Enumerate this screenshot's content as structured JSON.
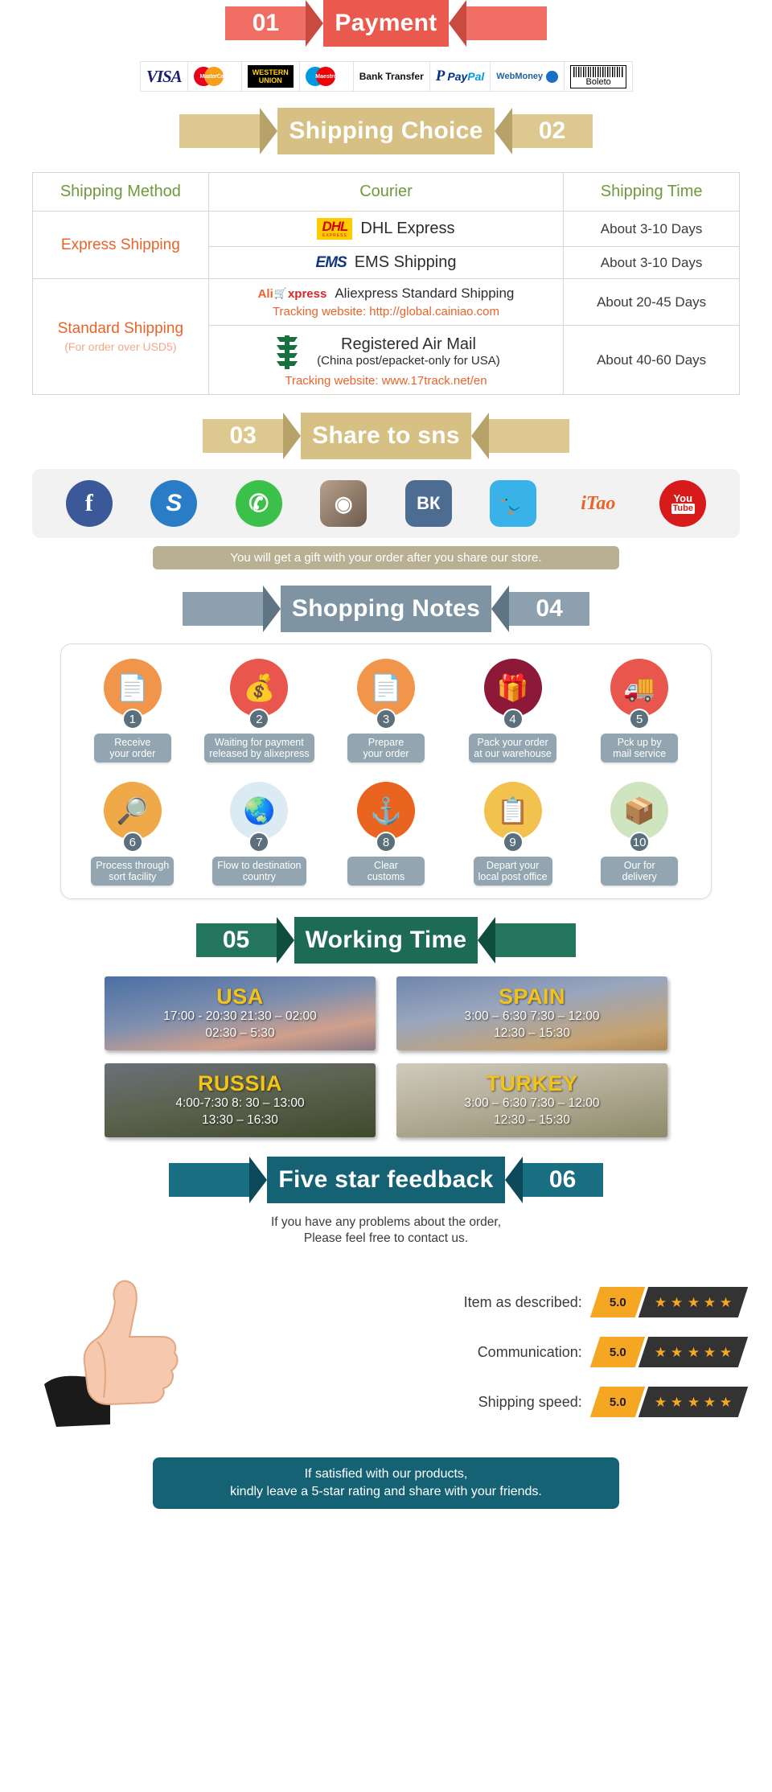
{
  "sections": {
    "payment": {
      "number": "01",
      "title": "Payment"
    },
    "shipping": {
      "number": "02",
      "title": "Shipping Choice"
    },
    "share": {
      "number": "03",
      "title": "Share to sns"
    },
    "notes": {
      "number": "04",
      "title": "Shopping Notes"
    },
    "working": {
      "number": "05",
      "title": "Working Time"
    },
    "feedback": {
      "number": "06",
      "title": "Five star feedback"
    }
  },
  "payment_methods": [
    {
      "name": "VISA",
      "icon": "visa-logo"
    },
    {
      "name": "MasterCard",
      "icon": "mastercard-logo"
    },
    {
      "name": "WESTERN UNION",
      "icon": "western-union-logo"
    },
    {
      "name": "Maestro",
      "icon": "maestro-logo"
    },
    {
      "name": "Bank Transfer",
      "icon": "bank-transfer-logo"
    },
    {
      "name": "PayPal",
      "icon": "paypal-logo"
    },
    {
      "name": "WebMoney",
      "icon": "webmoney-logo"
    },
    {
      "name": "Boleto",
      "icon": "boleto-logo"
    }
  ],
  "shipping_table": {
    "headers": {
      "method": "Shipping Method",
      "courier": "Courier",
      "time": "Shipping Time"
    },
    "groups": [
      {
        "method": "Express Shipping",
        "method_sub": "",
        "rows": [
          {
            "logo": "dhl-logo",
            "courier": "DHL Express",
            "courier_sub": "",
            "track": "",
            "time": "About 3-10 Days"
          },
          {
            "logo": "ems-logo",
            "courier": "EMS Shipping",
            "courier_sub": "",
            "track": "",
            "time": "About 3-10 Days"
          }
        ]
      },
      {
        "method": "Standard Shipping",
        "method_sub": "(For order over USD5)",
        "rows": [
          {
            "logo": "aliexpress-logo",
            "courier": "Aliexpress Standard Shipping",
            "courier_sub": "",
            "track": "Tracking website: http://global.cainiao.com",
            "time": "About 20-45 Days"
          },
          {
            "logo": "china-post-logo",
            "courier": "Registered Air Mail",
            "courier_sub": "(China post/epacket-only for USA)",
            "track": "Tracking website: www.17track.net/en",
            "time": "About 40-60 Days"
          }
        ]
      }
    ]
  },
  "social": {
    "items": [
      {
        "name": "facebook-icon",
        "label": "f",
        "color": "#3b5998",
        "shape": "circle"
      },
      {
        "name": "skype-icon",
        "label": "S",
        "color": "#2a7cc7",
        "shape": "circle"
      },
      {
        "name": "whatsapp-icon",
        "label": "✆",
        "color": "#3bc14a",
        "shape": "circle"
      },
      {
        "name": "instagram-icon",
        "label": "◉",
        "color": "#8a6a52",
        "shape": "square"
      },
      {
        "name": "vk-icon",
        "label": "ВК",
        "color": "#4c6c91",
        "shape": "square"
      },
      {
        "name": "twitter-icon",
        "label": "🐦",
        "color": "#38b2e8",
        "shape": "square"
      },
      {
        "name": "itao-icon",
        "label": "iTao",
        "color": "#ffffff",
        "shape": "plain"
      },
      {
        "name": "youtube-icon",
        "label": "You\nTube",
        "color": "#d71a1a",
        "shape": "circle"
      }
    ],
    "note": "You will get a gift with your order after you share our store."
  },
  "shopping_notes": {
    "steps": [
      {
        "num": "1",
        "label": "Receive\nyour order",
        "icon": "document-icon",
        "color": "#f0954a"
      },
      {
        "num": "2",
        "label": "Waiting for payment\nreleased by alixepress",
        "icon": "money-bag-icon",
        "color": "#e8564d"
      },
      {
        "num": "3",
        "label": "Prepare\nyour order",
        "icon": "document-icon",
        "color": "#f0954a"
      },
      {
        "num": "4",
        "label": "Pack your order\nat our warehouse",
        "icon": "gift-icon",
        "color": "#8d1838"
      },
      {
        "num": "5",
        "label": "Pck up by\nmail service",
        "icon": "mail-truck-icon",
        "color": "#e8564d"
      },
      {
        "num": "6",
        "label": "Process through\nsort facility",
        "icon": "scanner-icon",
        "color": "#f0a948"
      },
      {
        "num": "7",
        "label": "Flow to destination\ncountry",
        "icon": "globe-icon",
        "color": "#dceaf4"
      },
      {
        "num": "8",
        "label": "Clear\ncustoms",
        "icon": "anchor-icon",
        "color": "#e8641f"
      },
      {
        "num": "9",
        "label": "Depart your\nlocal post office",
        "icon": "clipboard-icon",
        "color": "#f2c14e"
      },
      {
        "num": "10",
        "label": "Our for\ndelivery",
        "icon": "package-icon",
        "color": "#cfe5c0"
      }
    ]
  },
  "working_time": {
    "cards": [
      {
        "country": "USA",
        "lines": [
          "17:00 - 20:30  21:30 – 02:00",
          "02:30 – 5:30"
        ],
        "theme": "usa"
      },
      {
        "country": "SPAIN",
        "lines": [
          "3:00 – 6:30   7:30 – 12:00",
          "12:30 – 15:30"
        ],
        "theme": "spain"
      },
      {
        "country": "RUSSIA",
        "lines": [
          "4:00-7:30   8: 30 – 13:00",
          "13:30 – 16:30"
        ],
        "theme": "russia"
      },
      {
        "country": "TURKEY",
        "lines": [
          "3:00 – 6:30   7:30 – 12:00",
          "12:30 – 15:30"
        ],
        "theme": "turkey"
      }
    ]
  },
  "feedback": {
    "intro_line1": "If you have any problems about the order,",
    "intro_line2": "Please feel free to contact us.",
    "ratings": [
      {
        "label": "Item as described:",
        "score": "5.0",
        "stars": 5
      },
      {
        "label": "Communication:",
        "score": "5.0",
        "stars": 5
      },
      {
        "label": "Shipping speed:",
        "score": "5.0",
        "stars": 5
      }
    ],
    "footer_line1": "If satisfied with our products,",
    "footer_line2": "kindly leave a 5-star rating and share with your friends."
  },
  "colors": {
    "red": "#e9594e",
    "gold": "#d7c083",
    "slate": "#7e94a3",
    "green": "#1d6b55",
    "teal": "#156275",
    "orange": "#e8642b",
    "green_text": "#6f9a3c",
    "star": "#f5a623"
  }
}
